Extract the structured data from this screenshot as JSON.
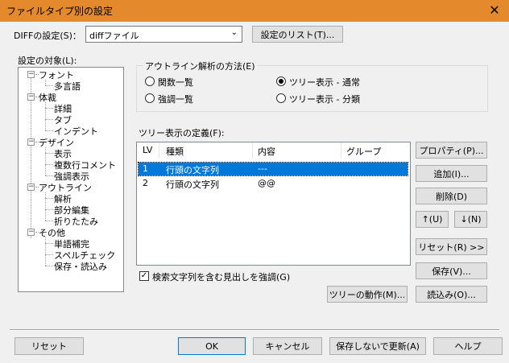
{
  "window": {
    "title": "ファイルタイプ別の設定",
    "close_glyph": "✕"
  },
  "top": {
    "label": "DIFFの設定(S)：",
    "combo_value": "diffファイル",
    "list_button": "設定のリスト(T)..."
  },
  "tree": {
    "label": "設定の対象(L):",
    "items": [
      {
        "label": "フォント",
        "expander": "−"
      },
      {
        "label": "多言語"
      },
      {
        "label": "体裁",
        "expander": "−"
      },
      {
        "label": "詳細"
      },
      {
        "label": "タブ"
      },
      {
        "label": "インデント"
      },
      {
        "label": "デザイン",
        "expander": "−"
      },
      {
        "label": "表示"
      },
      {
        "label": "複数行コメント"
      },
      {
        "label": "強調表示"
      },
      {
        "label": "アウトライン",
        "expander": "−"
      },
      {
        "label": "解析"
      },
      {
        "label": "部分編集"
      },
      {
        "label": "折りたたみ"
      },
      {
        "label": "その他",
        "expander": "−"
      },
      {
        "label": "単語補完"
      },
      {
        "label": "スペルチェック"
      },
      {
        "label": "保存・読込み"
      }
    ]
  },
  "method": {
    "title": "アウトライン解析の方法(E)",
    "options": [
      {
        "label": "関数一覧",
        "selected": false
      },
      {
        "label": "ツリー表示 - 通常",
        "selected": true
      },
      {
        "label": "強調一覧",
        "selected": false
      },
      {
        "label": "ツリー表示 - 分類",
        "selected": false
      }
    ]
  },
  "definition": {
    "label": "ツリー表示の定義(F):",
    "columns": [
      "LV",
      "種類",
      "内容",
      "グループ"
    ],
    "rows": [
      {
        "lv": "1",
        "kind": "行頭の文字列",
        "content": "---",
        "group": "",
        "selected": true
      },
      {
        "lv": "2",
        "kind": "行頭の文字列",
        "content": "@@",
        "group": "",
        "selected": false
      }
    ]
  },
  "side_buttons": {
    "properties": "プロパティ(P)...",
    "add": "追加(I)...",
    "delete": "削除(D)",
    "up": "↑(U)",
    "down": "↓(N)",
    "reset": "リセット(R) >>",
    "save": "保存(V)...",
    "load": "読込み(O)..."
  },
  "checkbox": {
    "label": "検索文字列を含む見出しを強調(G)",
    "checked": true,
    "mark": "✓"
  },
  "tree_action": "ツリーの動作(M)...",
  "footer": {
    "reset": "リセット",
    "ok": "OK",
    "cancel": "キャンセル",
    "update_no_save": "保存しないで更新(A)",
    "help": "ヘルプ"
  },
  "colors": {
    "title_bar": "#e48a2c",
    "selection": "#0078d7"
  }
}
